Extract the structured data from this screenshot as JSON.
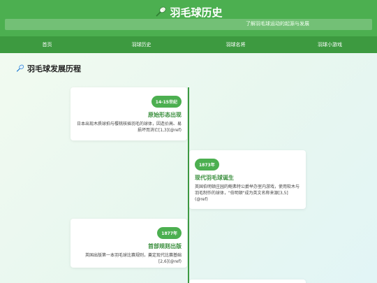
{
  "header": {
    "title": "羽毛球历史",
    "subtitle": "了解羽毛球运动的起源与发展"
  },
  "nav": {
    "items": [
      "首页",
      "羽球历史",
      "羽球名将",
      "羽球小游戏"
    ]
  },
  "section": {
    "title": "羽毛球发展历程"
  },
  "timeline": [
    {
      "year": "14-15世纪",
      "title": "原始形态出现",
      "text": "日本出现木质球拍与樱桃核插羽毛的球体，因造价高、易损坏而消亡[1,3](@ref)"
    },
    {
      "year": "1873年",
      "title": "现代羽毛球诞生",
      "text": "英国伯明顿庄园的鲍弗特公爵举办室内游戏，使用软木与羽毛制作的球体，\"伯明顿\"成为英文名称来源[3,5](@ref)"
    },
    {
      "year": "1877年",
      "title": "首部规则出版",
      "text": "英国出版第一本羽毛球比赛规则，奠定现代比赛基础[2,6](@ref)"
    }
  ],
  "colors": {
    "header": "#4caf50",
    "nav": "#3d9a40",
    "accent": "#4caf50",
    "card_title": "#3b8f3e",
    "timeline_line": "#3e9b43"
  },
  "icons": {
    "title": "badminton-racket-icon",
    "section": "badminton-racket-icon"
  }
}
